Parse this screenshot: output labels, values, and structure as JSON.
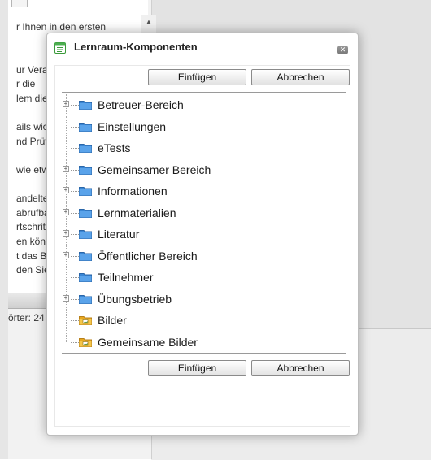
{
  "background": {
    "editor_lines": [
      "r Ihnen in den ersten",
      "",
      "",
      "ur Vera",
      "r die",
      "lem die",
      "",
      "ails wicl",
      "nd Prüfu",
      "",
      "wie etw",
      "",
      "andelte",
      "abrufbar",
      "rtschritt",
      "en könn",
      "t das B",
      "den Sie"
    ],
    "word_count": "örter: 24"
  },
  "dialog": {
    "title": "Lernraum-Komponenten",
    "close_icon": "close-x-icon",
    "buttons": {
      "insert": "Einfügen",
      "cancel": "Abbrechen"
    },
    "tree": [
      {
        "label": "Betreuer-Bereich",
        "expandable": true,
        "icon": "folder-blue-icon"
      },
      {
        "label": "Einstellungen",
        "expandable": false,
        "icon": "folder-blue-icon"
      },
      {
        "label": "eTests",
        "expandable": false,
        "icon": "folder-blue-icon"
      },
      {
        "label": "Gemeinsamer Bereich",
        "expandable": true,
        "icon": "folder-blue-icon"
      },
      {
        "label": "Informationen",
        "expandable": true,
        "icon": "folder-blue-icon"
      },
      {
        "label": "Lernmaterialien",
        "expandable": true,
        "icon": "folder-blue-icon"
      },
      {
        "label": "Literatur",
        "expandable": true,
        "icon": "folder-blue-icon"
      },
      {
        "label": "Öffentlicher Bereich",
        "expandable": true,
        "icon": "folder-blue-icon"
      },
      {
        "label": "Teilnehmer",
        "expandable": false,
        "icon": "folder-blue-icon"
      },
      {
        "label": "Übungsbetrieb",
        "expandable": true,
        "icon": "folder-blue-icon"
      },
      {
        "label": "Bilder",
        "expandable": false,
        "icon": "image-folder-icon"
      },
      {
        "label": "Gemeinsame Bilder",
        "expandable": false,
        "icon": "image-folder-icon"
      }
    ]
  },
  "colors": {
    "folder_blue": "#3a86d4",
    "image_folder": "#e8a820"
  }
}
